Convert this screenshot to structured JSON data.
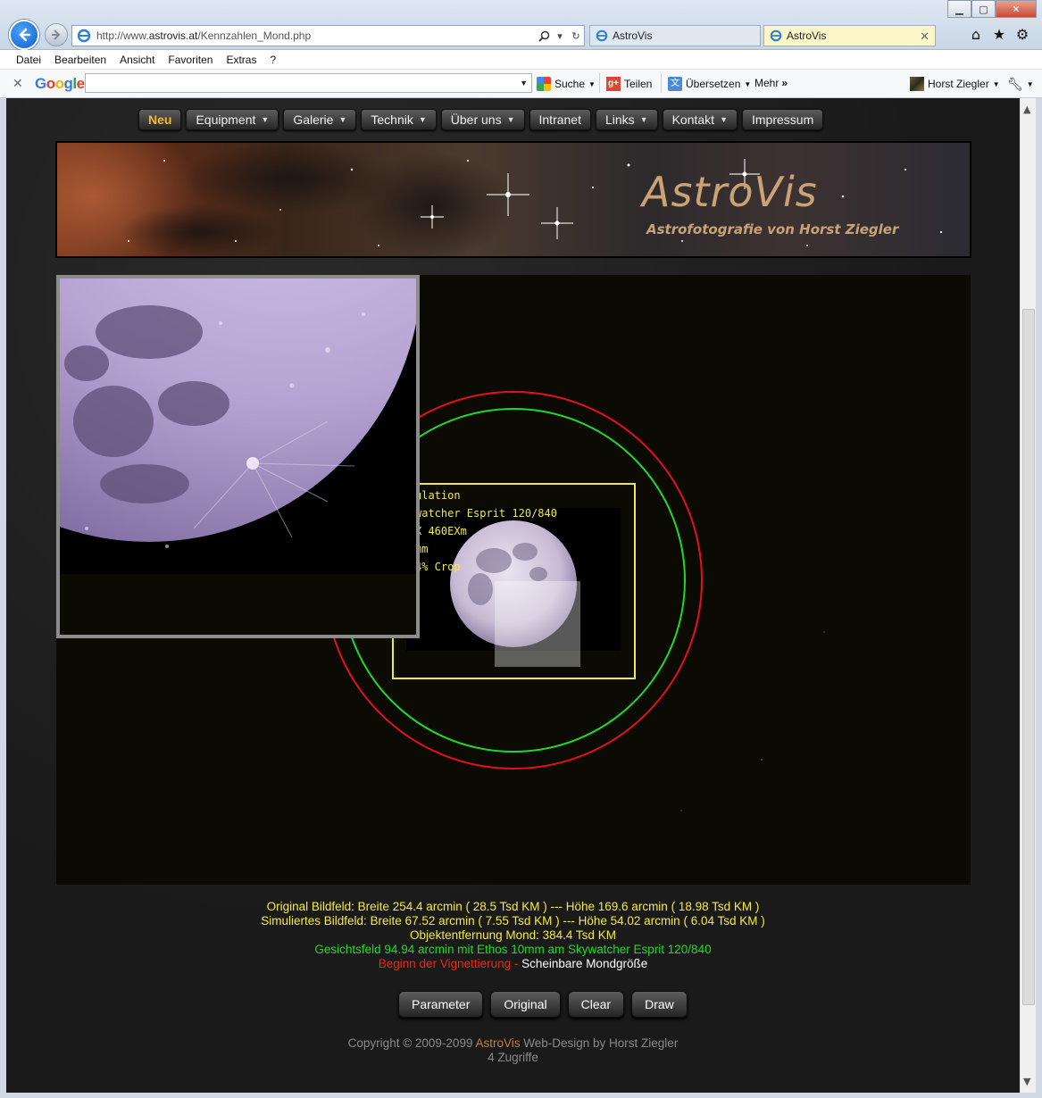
{
  "browser": {
    "url_prefix": "http://www.",
    "url_domain": "astrovis.at",
    "url_path": "/Kennzahlen_Mond.php",
    "tabs": [
      {
        "title": "AstroVis"
      },
      {
        "title": "AstroVis"
      }
    ],
    "menu": [
      "Datei",
      "Bearbeiten",
      "Ansicht",
      "Favoriten",
      "Extras",
      "?"
    ],
    "google_toolbar": {
      "logo": "Google",
      "search_label": "Suche",
      "share_label": "Teilen",
      "translate_label": "Übersetzen",
      "more_label": "Mehr",
      "user_name": "Horst Ziegler"
    }
  },
  "site": {
    "nav": [
      {
        "label": "Neu",
        "has_dropdown": false,
        "active": true
      },
      {
        "label": "Equipment",
        "has_dropdown": true
      },
      {
        "label": "Galerie",
        "has_dropdown": true
      },
      {
        "label": "Technik",
        "has_dropdown": true
      },
      {
        "label": "Über uns",
        "has_dropdown": true
      },
      {
        "label": "Intranet",
        "has_dropdown": false
      },
      {
        "label": "Links",
        "has_dropdown": true
      },
      {
        "label": "Kontakt",
        "has_dropdown": true
      },
      {
        "label": "Impressum",
        "has_dropdown": false
      }
    ],
    "banner": {
      "title": "AstroVis",
      "subtitle": "Astrofotografie von Horst Ziegler"
    },
    "simulation_overlay_lines": [
      "ulation",
      "watcher Esprit 120/840",
      "X 460EXm",
      "mm",
      "4% Crop"
    ],
    "stats": {
      "original": "Original Bildfeld: Breite 254.4 arcmin ( 28.5 Tsd KM ) --- Höhe 169.6 arcmin ( 18.98 Tsd KM )",
      "simulated": "Simuliertes Bildfeld: Breite 67.52 arcmin ( 7.55 Tsd KM ) --- Höhe 54.02 arcmin ( 6.04 Tsd KM )",
      "distance": "Objektentfernung Mond: 384.4 Tsd KM",
      "fov": "Gesichtsfeld 94.94 arcmin mit Ethos 10mm am Skywatcher Esprit 120/840",
      "vignette": "Beginn der Vignettierung",
      "separator": " - ",
      "apparent": "Scheinbare Mondgröße"
    },
    "buttons": {
      "parameter": "Parameter",
      "original": "Original",
      "clear": "Clear",
      "draw": "Draw"
    },
    "footer": {
      "copyright_prefix": "Copyright © 2009-2099 ",
      "brand": "AstroVis",
      "copyright_suffix": " Web-Design by Horst Ziegler",
      "visits": "4 Zugriffe"
    },
    "colors": {
      "vignette_circle": "#e3111a",
      "fov_circle": "#22d62b",
      "frame_rect": "#f1e84a",
      "nav_active": "#f5b53a"
    }
  }
}
